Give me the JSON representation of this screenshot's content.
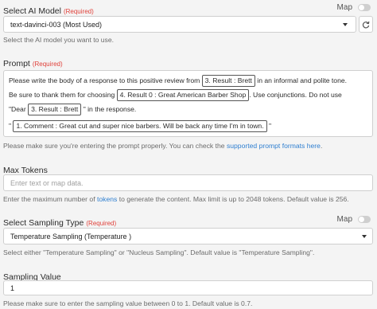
{
  "model": {
    "label": "Select AI Model",
    "required": "(Required)",
    "map_label": "Map",
    "value": "text-davinci-003 (Most Used)",
    "help": "Select the AI model you want to use."
  },
  "prompt": {
    "label": "Prompt",
    "required": "(Required)",
    "line1_a": "Please write the body of a response to this positive review from",
    "pill1": "3. Result : Brett",
    "line1_b": "in an informal and polite tone.",
    "line2_a": "Be sure to thank them for choosing",
    "pill2": "4. Result 0 : Great American Barber Shop",
    "line2_b": ". Use conjunctions. Do not use",
    "line3_a": "\"Dear",
    "pill3": "3. Result : Brett",
    "line3_b": "\" in the response.",
    "line4_a": "\"",
    "pill4": "1. Comment : Great cut and super nice barbers. Will be back any time I'm in town.",
    "line4_b": "\"",
    "help_a": "Please make sure you're entering the prompt properly. You can check the",
    "help_link": "supported prompt formats here",
    "help_b": "."
  },
  "max_tokens": {
    "label": "Max Tokens",
    "placeholder": "Enter text or map data.",
    "help_a": "Enter the maximum number of",
    "help_link": "tokens",
    "help_b": "to generate the content. Max limit is up to 2048 tokens. Default value is 256."
  },
  "sampling_type": {
    "label": "Select Sampling Type",
    "required": "(Required)",
    "map_label": "Map",
    "value": "Temperature Sampling (Temperature )",
    "help": "Select either \"Temperature Sampling\" or \"Nucleus Sampling\". Default value is \"Temperature Sampling\"."
  },
  "sampling_value": {
    "label": "Sampling Value",
    "value": "1",
    "help": "Please make sure to enter the sampling value between 0 to 1. Default value is 0.7."
  }
}
